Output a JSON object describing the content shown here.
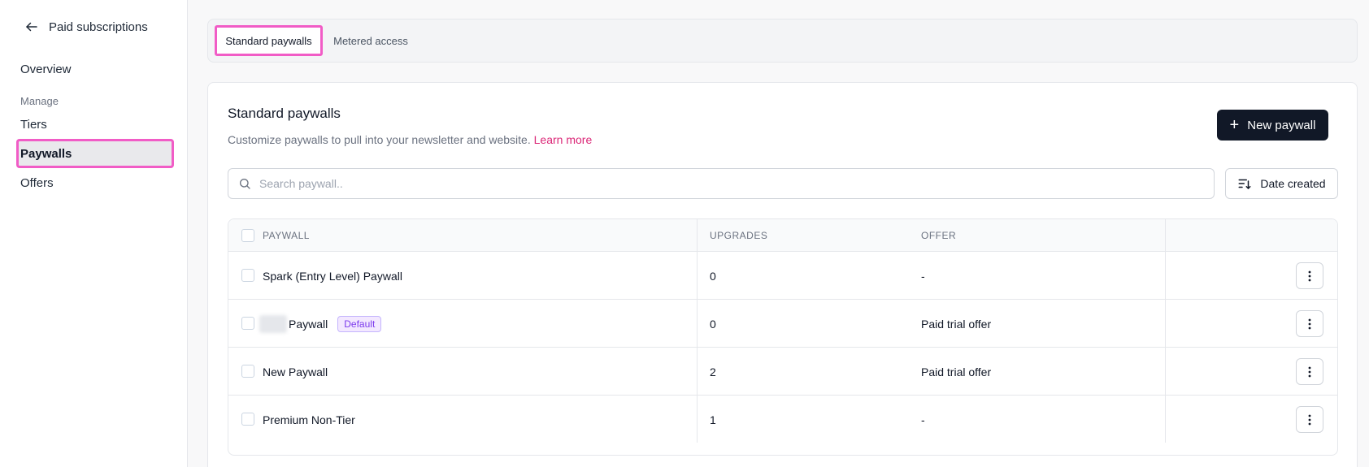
{
  "sidebar": {
    "back_label": "Paid subscriptions",
    "overview": "Overview",
    "section_manage": "Manage",
    "tiers": "Tiers",
    "paywalls": "Paywalls",
    "offers": "Offers"
  },
  "tabs": {
    "standard": "Standard paywalls",
    "metered": "Metered access"
  },
  "card": {
    "title": "Standard paywalls",
    "description": "Customize paywalls to pull into your newsletter and website.",
    "learn_more": "Learn more",
    "new_button": "New paywall",
    "search_placeholder": "Search paywall..",
    "sort_label": "Date created"
  },
  "table": {
    "headers": {
      "paywall": "PAYWALL",
      "upgrades": "UPGRADES",
      "offer": "OFFER"
    },
    "rows": [
      {
        "name": "Spark (Entry Level) Paywall",
        "upgrades": "0",
        "offer": "-"
      },
      {
        "name": "Paywall",
        "badge": "Default",
        "upgrades": "0",
        "offer": "Paid trial offer"
      },
      {
        "name": "New Paywall",
        "upgrades": "2",
        "offer": "Paid trial offer"
      },
      {
        "name": "Premium Non-Tier",
        "upgrades": "1",
        "offer": "-"
      }
    ]
  },
  "colors": {
    "primary_button": "#111827",
    "link": "#db2777",
    "highlight": "#f15cc6",
    "badge_text": "#7c3aed"
  }
}
